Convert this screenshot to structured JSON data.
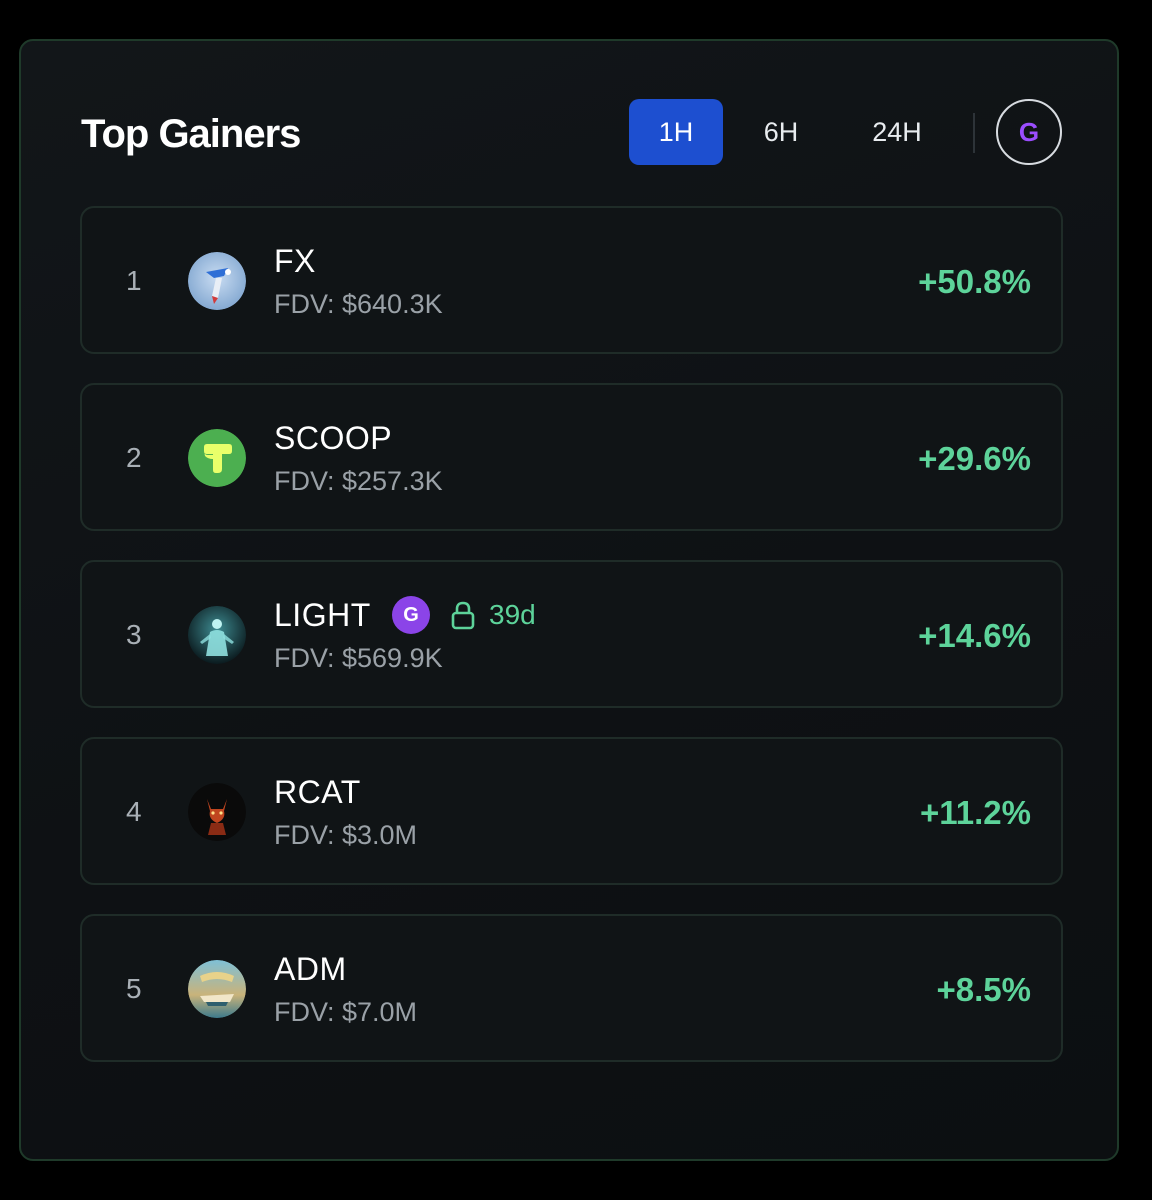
{
  "title": "Top Gainers",
  "tabs": [
    {
      "label": "1H",
      "active": true
    },
    {
      "label": "6H",
      "active": false
    },
    {
      "label": "24H",
      "active": false
    }
  ],
  "filter_badge": "G",
  "colors": {
    "accent": "#1d4fd0",
    "positive": "#5dd39a",
    "badge_purple": "#8b44e8",
    "panel_border": "#1f3a2a"
  },
  "rows": [
    {
      "rank": "1",
      "name": "FX",
      "fdv": "FDV: $640.3K",
      "change": "+50.8%",
      "icon": "fx-token-avatar"
    },
    {
      "rank": "2",
      "name": "SCOOP",
      "fdv": "FDV: $257.3K",
      "change": "+29.6%",
      "icon": "scoop-token-avatar"
    },
    {
      "rank": "3",
      "name": "LIGHT",
      "fdv": "FDV: $569.9K",
      "change": "+14.6%",
      "icon": "light-token-avatar",
      "badge": "G",
      "lock_label": "39d"
    },
    {
      "rank": "4",
      "name": "RCAT",
      "fdv": "FDV: $3.0M",
      "change": "+11.2%",
      "icon": "rcat-token-avatar"
    },
    {
      "rank": "5",
      "name": "ADM",
      "fdv": "FDV: $7.0M",
      "change": "+8.5%",
      "icon": "adm-token-avatar"
    }
  ]
}
